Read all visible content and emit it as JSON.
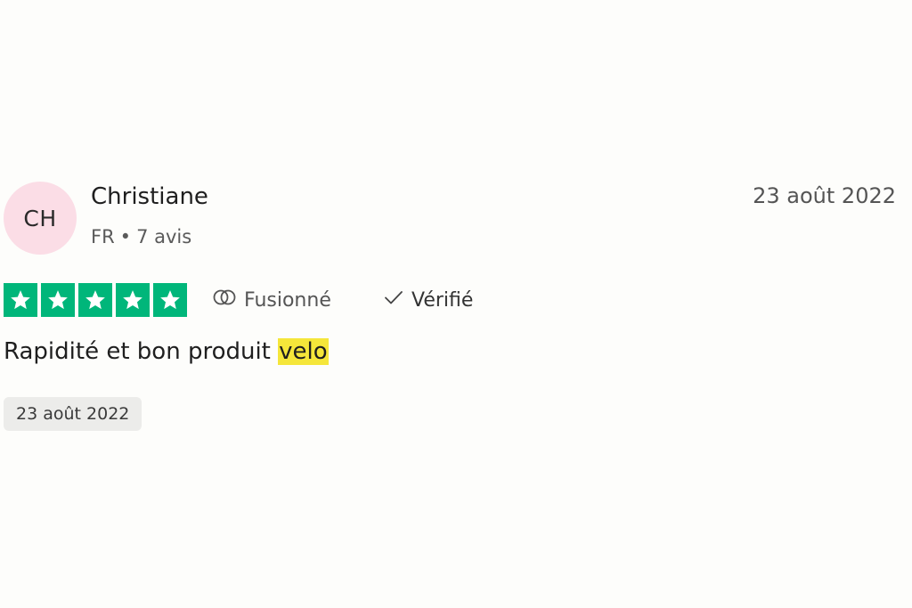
{
  "reviewer": {
    "initials": "CH",
    "name": "Christiane",
    "country": "FR",
    "separator": "•",
    "review_count": "7 avis"
  },
  "review": {
    "date": "23 août 2022",
    "rating": 5,
    "rating_max": 5,
    "merged_label": "Fusionné",
    "verified_label": "Vérifié",
    "text_before": "Rapidité et bon produit ",
    "text_highlight": "velo",
    "experience_date": "23 août 2022"
  },
  "colors": {
    "star_green": "#00b67a",
    "avatar_bg": "#fbdde6",
    "highlight": "#f5e63a",
    "chip_bg": "#ececea"
  },
  "icons": {
    "star": "star-icon",
    "merged": "merge-circles-icon",
    "verified": "check-icon"
  }
}
